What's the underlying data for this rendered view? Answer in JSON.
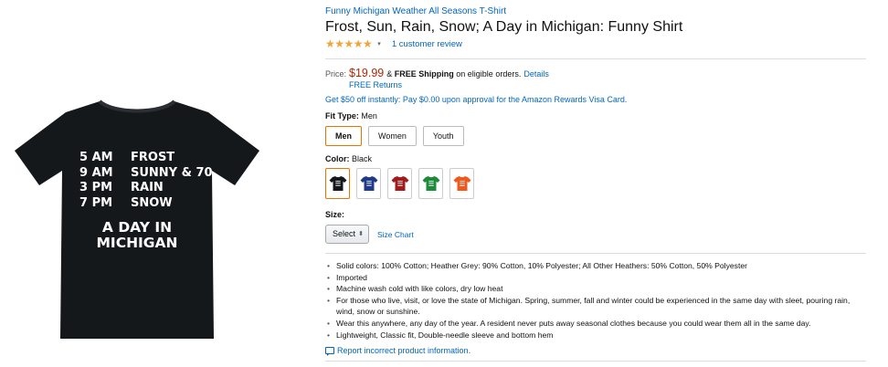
{
  "product": {
    "brand": "Funny Michigan Weather All Seasons T-Shirt",
    "title": "Frost, Sun, Rain, Snow; A Day in Michigan: Funny Shirt",
    "stars": "★★★★★",
    "rating_dropdown": "▾",
    "reviews": "1 customer review"
  },
  "image": {
    "shirt_color": "#15181b",
    "schedule": [
      {
        "time": "5 AM",
        "weather": "FROST"
      },
      {
        "time": "9 AM",
        "weather": "SUNNY & 70"
      },
      {
        "time": "3 PM",
        "weather": "RAIN"
      },
      {
        "time": "7 PM",
        "weather": "SNOW"
      }
    ],
    "tagline_1": "A DAY IN",
    "tagline_2": "MICHIGAN"
  },
  "price": {
    "label": "Price:",
    "amount": "$19.99",
    "shipping_prefix": "&",
    "shipping_bold": "FREE Shipping",
    "shipping_suffix": "on eligible orders.",
    "details_link": "Details",
    "free_returns": "FREE Returns",
    "promo": "Get $50 off instantly: Pay $0.00 upon approval for the Amazon Rewards Visa Card."
  },
  "fit": {
    "label": "Fit Type:",
    "selected": "Men",
    "options": [
      "Men",
      "Women",
      "Youth"
    ]
  },
  "color": {
    "label": "Color:",
    "selected": "Black",
    "swatches": [
      "#15181b",
      "#1f3a8a",
      "#9e1c1c",
      "#1f8a3a",
      "#ee5a1e"
    ],
    "accent": "#e77600"
  },
  "size": {
    "label": "Size:",
    "select_value": "Select",
    "select_arrow": "⬍",
    "size_chart": "Size Chart"
  },
  "bullets": [
    "Solid colors: 100% Cotton; Heather Grey: 90% Cotton, 10% Polyester; All Other Heathers: 50% Cotton, 50% Polyester",
    "Imported",
    "Machine wash cold with like colors, dry low heat",
    "For those who live, visit, or love the state of Michigan. Spring, summer, fall and winter could be experienced in the same day with sleet, pouring rain, wind, snow or sunshine.",
    "Wear this anywhere, any day of the year. A resident never puts away seasonal clothes because you could wear them all in the same day.",
    "Lightweight, Classic fit, Double-needle sleeve and bottom hem"
  ],
  "report": {
    "icon": "speech-bubble-icon",
    "text": "Report incorrect product information."
  }
}
